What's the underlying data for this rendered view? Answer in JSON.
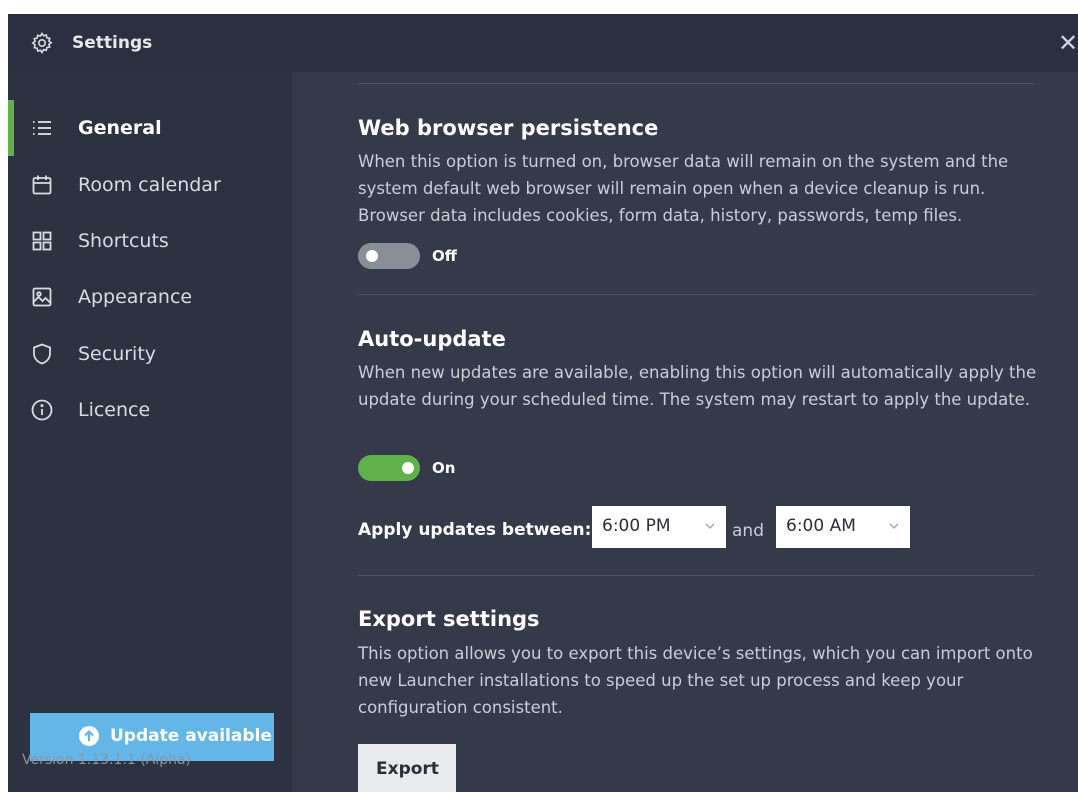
{
  "window": {
    "title": "Settings"
  },
  "sidebar": {
    "items": [
      {
        "label": "General",
        "icon": "list-icon",
        "active": true
      },
      {
        "label": "Room calendar",
        "icon": "calendar-icon",
        "active": false
      },
      {
        "label": "Shortcuts",
        "icon": "grid-icon",
        "active": false
      },
      {
        "label": "Appearance",
        "icon": "image-icon",
        "active": false
      },
      {
        "label": "Security",
        "icon": "shield-icon",
        "active": false
      },
      {
        "label": "Licence",
        "icon": "info-icon",
        "active": false
      }
    ],
    "update_button": "Update available",
    "version": "Version 1.13.1.1 (Alpha)"
  },
  "sections": {
    "browser_persistence": {
      "title": "Web browser persistence",
      "description": "When this option is turned on, browser data will remain on the system and the system default web browser will remain open when a device cleanup is run. Browser data includes cookies, form data, history, passwords, temp files.",
      "toggle_state": "Off"
    },
    "auto_update": {
      "title": "Auto-update",
      "description": "When new updates are available, enabling this option will automatically apply the update during your scheduled time. The system may restart to apply the update.",
      "toggle_state": "On",
      "apply_label": "Apply updates between:",
      "start_time": "6:00 PM",
      "and_text": "and",
      "end_time": "6:00 AM"
    },
    "export": {
      "title": "Export settings",
      "description": "This option allows you to export this device’s settings, which you can import onto new Launcher installations to speed up the set up process and keep your configuration consistent.",
      "button": "Export"
    }
  },
  "colors": {
    "accent_green": "#5fb14a",
    "update_blue": "#63b6e8",
    "background": "#2f3445"
  }
}
